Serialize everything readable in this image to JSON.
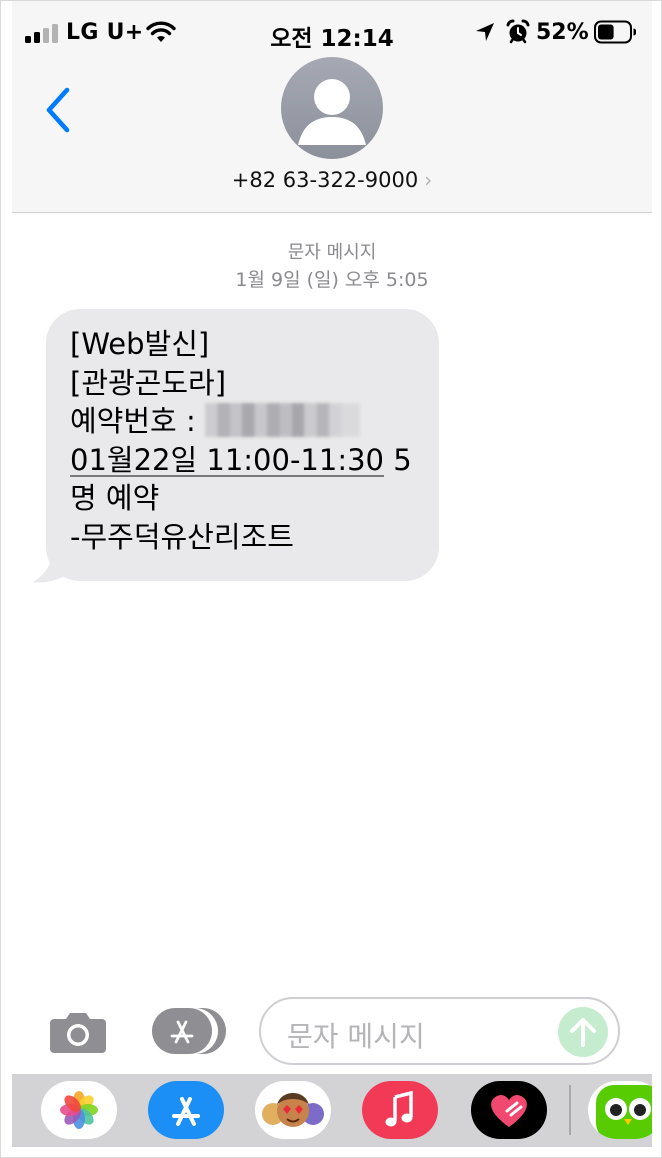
{
  "status_bar": {
    "carrier": "LG U+",
    "time": "오전 12:14",
    "battery_percent": "52%",
    "battery_level": 0.52,
    "signal_bars": 2,
    "icons": [
      "signal-icon",
      "wifi-icon",
      "location-icon",
      "alarm-icon",
      "battery-icon"
    ]
  },
  "header": {
    "back_icon": "chevron-left-icon",
    "avatar_icon": "person-silhouette-icon",
    "contact_number": "+82 63-322-9000",
    "chevron": "›"
  },
  "conversation": {
    "service_label": "문자 메시지",
    "timestamp": "1월 9일 (일) 오후 5:05",
    "message": {
      "line1": "[Web발신]",
      "line2": "[관광곤도라]",
      "line3_prefix": "예약번호 : ",
      "line3_redacted": true,
      "line4_link": "01월22일 11:00-11:30",
      "line4_suffix": " 5",
      "line5": "명 예약",
      "line6": "-무주덕유산리조트"
    }
  },
  "input_bar": {
    "camera_icon": "camera-icon",
    "apps_icon": "app-store-icon",
    "placeholder": "문자 메시지",
    "send_icon": "arrow-up-icon"
  },
  "app_drawer": {
    "apps": [
      {
        "name": "photos-app-icon"
      },
      {
        "name": "app-store-app-icon"
      },
      {
        "name": "memoji-app-icon"
      },
      {
        "name": "music-app-icon"
      },
      {
        "name": "heart-app-icon"
      },
      {
        "name": "duolingo-app-icon"
      }
    ]
  },
  "colors": {
    "accent": "#007aff",
    "bubble": "#e9e9eb",
    "header_bg": "#f6f6f6",
    "meta_text": "#8a8a8e",
    "send_button": "#c6ecd0"
  }
}
